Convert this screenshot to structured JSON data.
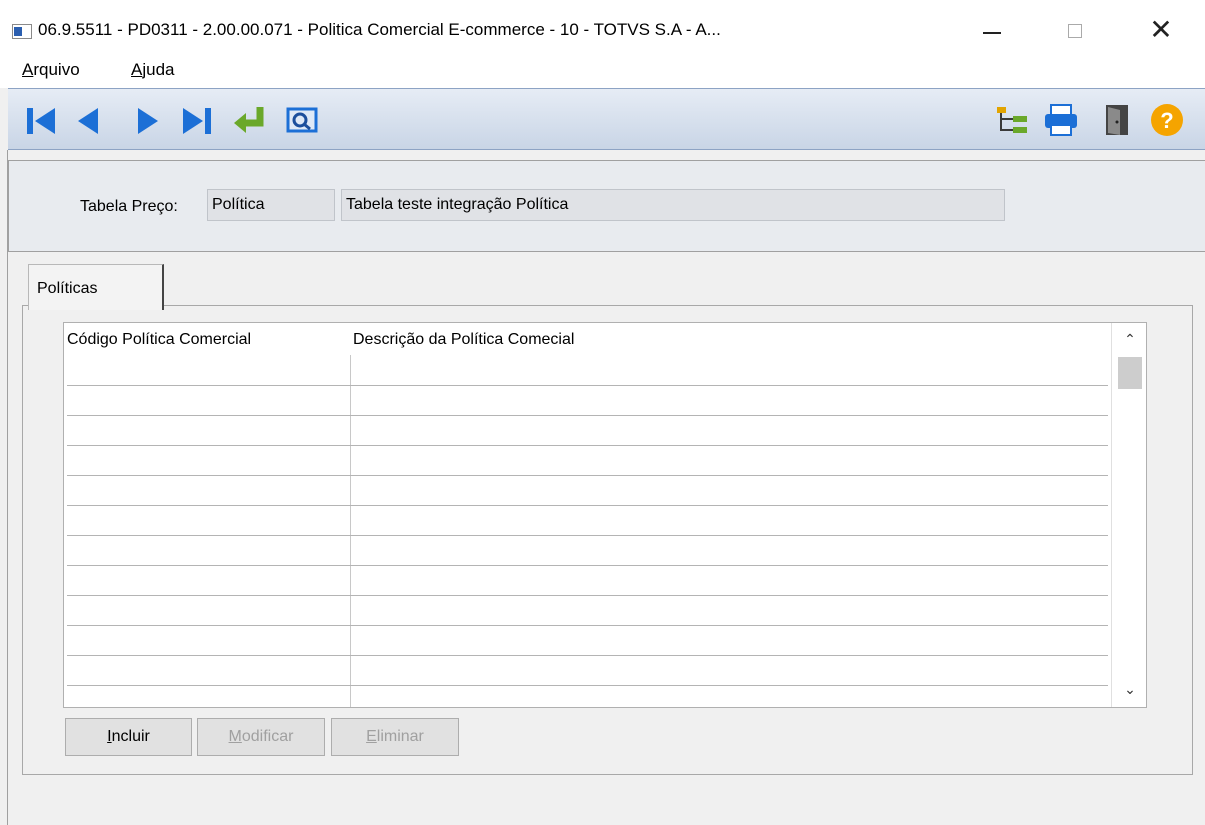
{
  "window": {
    "title": "06.9.5511 - PD0311 - 2.00.00.071 - Politica Comercial E-commerce - 10 - TOTVS S.A - A...",
    "minimize": "—",
    "maximize": "□",
    "close": "✕"
  },
  "menu": [
    {
      "accel": "A",
      "rest": "rquivo"
    },
    {
      "accel": "A",
      "rest": "juda"
    }
  ],
  "toolbar": {
    "left_icons": [
      "first-record-icon",
      "previous-record-icon",
      "next-record-icon",
      "last-record-icon",
      "go-to-icon",
      "search-icon"
    ],
    "right_icons": [
      "tree-icon",
      "print-icon",
      "exit-door-icon",
      "help-icon"
    ]
  },
  "header": {
    "tabela_label": "Tabela Preço:",
    "tabela_code": "Política",
    "tabela_desc": "Tabela teste integração Política"
  },
  "tabs": [
    {
      "label": "Políticas"
    }
  ],
  "grid": {
    "columns": [
      "Código Política Comercial",
      "Descrição da Política Comecial"
    ],
    "rows": []
  },
  "buttons": {
    "incluir": {
      "accel": "I",
      "rest": "ncluir"
    },
    "modificar": {
      "accel": "M",
      "rest": "odificar"
    },
    "eliminar": {
      "accel": "E",
      "rest": "liminar"
    }
  },
  "colors": {
    "toolbar_blue": "#1c6fd6",
    "enter_green": "#6aa82a",
    "help_orange": "#f5a400"
  }
}
